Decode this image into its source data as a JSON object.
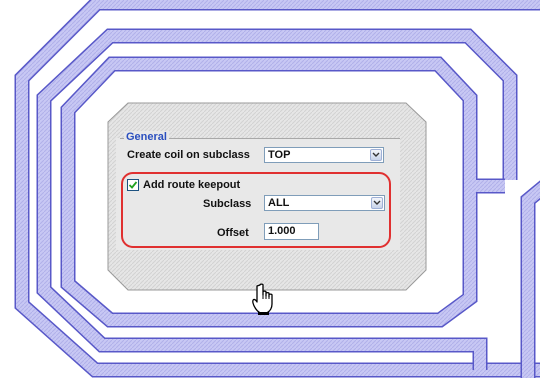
{
  "panel": {
    "group_title": "General",
    "coil_label": "Create coil on subclass",
    "coil_value": "TOP",
    "keepout_label": "Add route keepout",
    "keepout_checked": true,
    "subclass_label": "Subclass",
    "subclass_value": "ALL",
    "offset_label": "Offset",
    "offset_value": "1.000"
  },
  "colors": {
    "coil_fill": "#c8c8f4",
    "coil_edge": "#5858c8",
    "highlight": "#e03030",
    "group_title": "#2b4fbf"
  },
  "icons": [
    "dropdown-arrow-icon",
    "checkmark-icon",
    "hand-pointer-cursor-icon"
  ]
}
